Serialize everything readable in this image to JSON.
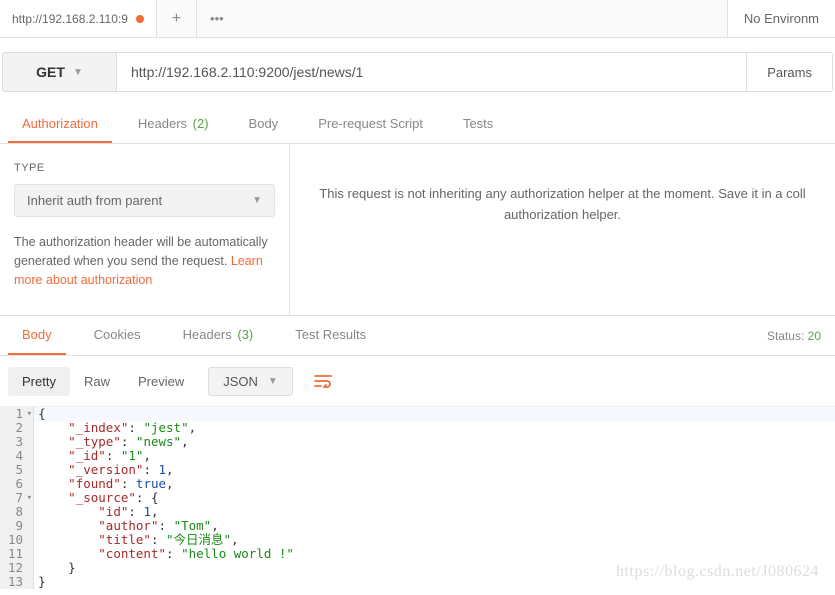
{
  "top": {
    "tab_title": "http://192.168.2.110:9",
    "env_label": "No Environm"
  },
  "request": {
    "method": "GET",
    "url": "http://192.168.2.110:9200/jest/news/1",
    "params_btn": "Params"
  },
  "req_tabs": {
    "authorization": "Authorization",
    "headers": "Headers",
    "headers_count": "(2)",
    "body": "Body",
    "prerequest": "Pre-request Script",
    "tests": "Tests"
  },
  "auth": {
    "type_label": "TYPE",
    "selected": "Inherit auth from parent",
    "help_text": "The authorization header will be automatically generated when you send the request. ",
    "link_text": "Learn more about authorization",
    "right_text": "This request is not inheriting any authorization helper at the moment. Save it in a coll",
    "right_text2": "authorization helper."
  },
  "res_tabs": {
    "body": "Body",
    "cookies": "Cookies",
    "headers": "Headers",
    "headers_count": "(3)",
    "tests": "Test Results"
  },
  "status": {
    "label": "Status:",
    "code": "20"
  },
  "format": {
    "pretty": "Pretty",
    "raw": "Raw",
    "preview": "Preview",
    "type": "JSON"
  },
  "chart_data": {
    "type": "table",
    "response_json": {
      "_index": "jest",
      "_type": "news",
      "_id": "1",
      "_version": 1,
      "found": true,
      "_source": {
        "id": 1,
        "author": "Tom",
        "title": "今日消息",
        "content": "hello world !"
      }
    }
  },
  "code_lines": [
    {
      "n": 1,
      "fold": true,
      "indent": 0,
      "raw": "{"
    },
    {
      "n": 2,
      "indent": 1,
      "key": "_index",
      "vstr": "jest",
      "comma": true
    },
    {
      "n": 3,
      "indent": 1,
      "key": "_type",
      "vstr": "news",
      "comma": true
    },
    {
      "n": 4,
      "indent": 1,
      "key": "_id",
      "vstr": "1",
      "comma": true
    },
    {
      "n": 5,
      "indent": 1,
      "key": "_version",
      "vnum": "1",
      "comma": true
    },
    {
      "n": 6,
      "indent": 1,
      "key": "found",
      "vnum": "true",
      "comma": true
    },
    {
      "n": 7,
      "fold": true,
      "indent": 1,
      "key": "_source",
      "vbrace": "{"
    },
    {
      "n": 8,
      "indent": 2,
      "key": "id",
      "vnum": "1",
      "comma": true
    },
    {
      "n": 9,
      "indent": 2,
      "key": "author",
      "vstr": "Tom",
      "comma": true
    },
    {
      "n": 10,
      "indent": 2,
      "key": "title",
      "vstr": "今日消息",
      "comma": true
    },
    {
      "n": 11,
      "indent": 2,
      "key": "content",
      "vstr": "hello world !"
    },
    {
      "n": 12,
      "indent": 1,
      "raw": "}"
    },
    {
      "n": 13,
      "indent": 0,
      "raw": "}"
    }
  ],
  "watermark": "https://blog.csdn.net/J080624"
}
